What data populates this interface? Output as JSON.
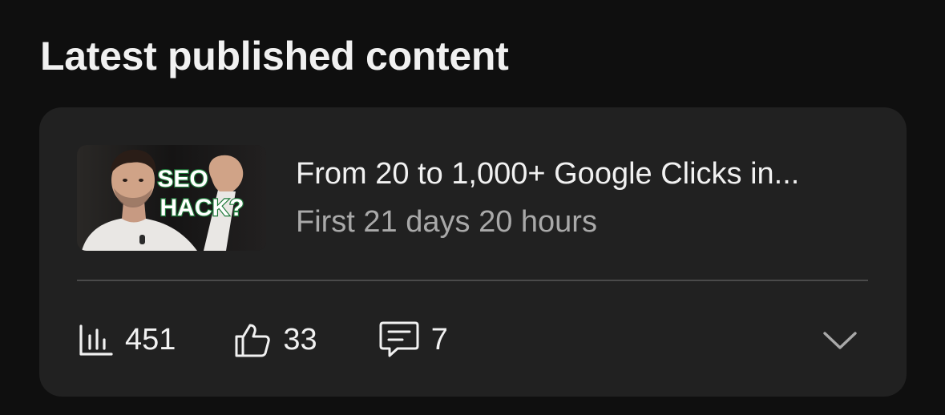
{
  "section": {
    "title": "Latest published content"
  },
  "video": {
    "title": "From 20 to 1,000+ Google Clicks in...",
    "age": "First 21 days 20 hours",
    "thumbnail": {
      "overlay_line1": "SEO",
      "overlay_line2": "HACK?"
    }
  },
  "stats": {
    "views": "451",
    "likes": "33",
    "comments": "7"
  },
  "icons": {
    "views": "bar-chart-icon",
    "likes": "thumbs-up-icon",
    "comments": "comment-icon",
    "expand": "chevron-down-icon"
  },
  "colors": {
    "background": "#0f0f0f",
    "card": "#212121",
    "text_primary": "#f1f1f1",
    "text_secondary": "#a9a9a9",
    "thumbnail_text_fill": "#ffffff",
    "thumbnail_text_stroke": "#1f7a3a"
  }
}
